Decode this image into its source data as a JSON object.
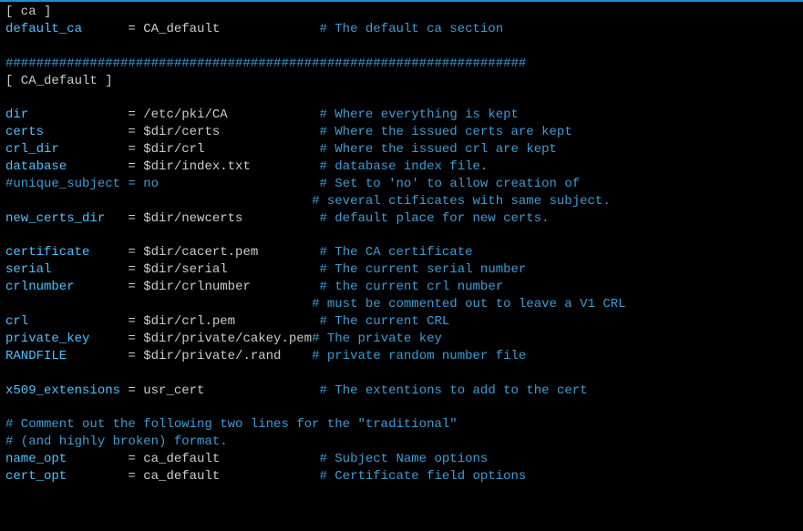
{
  "lines": [
    {
      "sec": "[ ca ]"
    },
    {
      "kw": "default_ca",
      "eqpad": "      = ",
      "val": "CA_default",
      "valpad": "             ",
      "cmt": "# The default ca section"
    },
    {
      "blank": true
    },
    {
      "cmt_full": "####################################################################"
    },
    {
      "sec": "[ CA_default ]"
    },
    {
      "blank": true
    },
    {
      "kw": "dir",
      "eqpad": "             = ",
      "val": "/etc/pki/CA",
      "valpad": "            ",
      "cmt": "# Where everything is kept"
    },
    {
      "kw": "certs",
      "eqpad": "           = ",
      "val": "$dir/certs",
      "valpad": "             ",
      "cmt": "# Where the issued certs are kept"
    },
    {
      "kw": "crl_dir",
      "eqpad": "         = ",
      "val": "$dir/crl",
      "valpad": "               ",
      "cmt": "# Where the issued crl are kept"
    },
    {
      "kw": "database",
      "eqpad": "        = ",
      "val": "$dir/index.txt",
      "valpad": "         ",
      "cmt": "# database index file."
    },
    {
      "cmt_line": true,
      "kw_cmt": "#unique_subject",
      "eqpad": " = ",
      "val_cmt": "no",
      "valpad": "                     ",
      "cmt": "# Set to 'no' to allow creation of"
    },
    {
      "indent": "                                        ",
      "cmt": "# several ctificates with same subject."
    },
    {
      "kw": "new_certs_dir",
      "eqpad": "   = ",
      "val": "$dir/newcerts",
      "valpad": "          ",
      "cmt": "# default place for new certs."
    },
    {
      "blank": true
    },
    {
      "kw": "certificate",
      "eqpad": "     = ",
      "val": "$dir/cacert.pem",
      "valpad": "        ",
      "cmt": "# The CA certificate"
    },
    {
      "kw": "serial",
      "eqpad": "          = ",
      "val": "$dir/serial",
      "valpad": "            ",
      "cmt": "# The current serial number"
    },
    {
      "kw": "crlnumber",
      "eqpad": "       = ",
      "val": "$dir/crlnumber",
      "valpad": "         ",
      "cmt": "# the current crl number"
    },
    {
      "indent": "                                        ",
      "cmt": "# must be commented out to leave a V1 CRL"
    },
    {
      "kw": "crl",
      "eqpad": "             = ",
      "val": "$dir/crl.pem",
      "valpad": "           ",
      "cmt": "# The current CRL"
    },
    {
      "kw": "private_key",
      "eqpad": "     = ",
      "val": "$dir/private/cakey.pem",
      "valpad": "",
      "cmt": "# The private key"
    },
    {
      "kw": "RANDFILE",
      "eqpad": "        = ",
      "val": "$dir/private/.rand",
      "valpad": "    ",
      "cmt": "# private random number file"
    },
    {
      "blank": true
    },
    {
      "kw": "x509_extensions",
      "eqpad": " = ",
      "val": "usr_cert",
      "valpad": "               ",
      "cmt": "# The extentions to add to the cert"
    },
    {
      "blank": true
    },
    {
      "cmt_full": "# Comment out the following two lines for the \"traditional\""
    },
    {
      "cmt_full": "# (and highly broken) format."
    },
    {
      "kw": "name_opt",
      "eqpad": "        = ",
      "val": "ca_default",
      "valpad": "             ",
      "cmt": "# Subject Name options"
    },
    {
      "kw": "cert_opt",
      "eqpad": "        = ",
      "val": "ca_default",
      "valpad": "             ",
      "cmt": "# Certificate field options"
    }
  ]
}
